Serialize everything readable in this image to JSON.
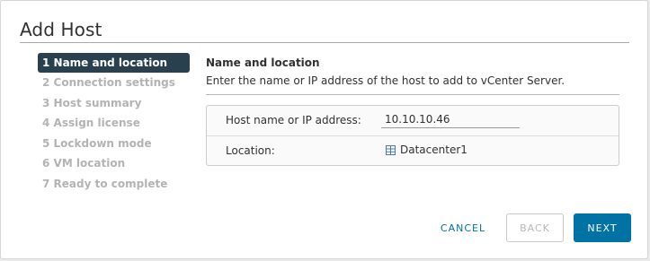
{
  "dialog": {
    "title": "Add Host"
  },
  "steps": [
    {
      "label": "1 Name and location",
      "active": true
    },
    {
      "label": "2 Connection settings",
      "active": false
    },
    {
      "label": "3 Host summary",
      "active": false
    },
    {
      "label": "4 Assign license",
      "active": false
    },
    {
      "label": "5 Lockdown mode",
      "active": false
    },
    {
      "label": "6 VM location",
      "active": false
    },
    {
      "label": "7 Ready to complete",
      "active": false
    }
  ],
  "pane": {
    "heading": "Name and location",
    "description": "Enter the name or IP address of the host to add to vCenter Server."
  },
  "form": {
    "host_label": "Host name or IP address:",
    "host_value": "10.10.10.46",
    "location_label": "Location:",
    "location_value": "Datacenter1",
    "location_icon": "datacenter-icon"
  },
  "buttons": {
    "cancel": "CANCEL",
    "back": "BACK",
    "next": "NEXT"
  },
  "colors": {
    "accent": "#0072a3",
    "active_step_bg": "#29414e",
    "disabled_text": "#b3b3b3"
  }
}
